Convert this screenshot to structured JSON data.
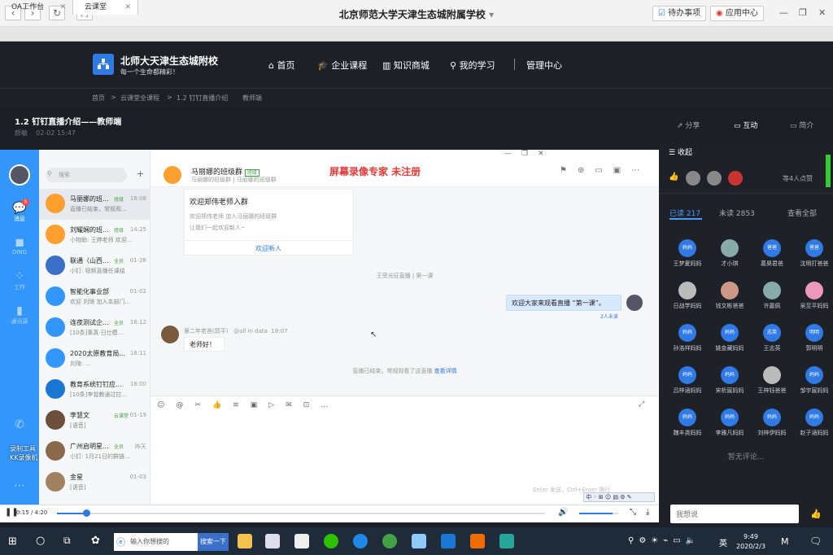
{
  "browser": {
    "title": "北京师范大学天津生态城附属学校",
    "title_caret": "▾",
    "todo_label": "待办事项",
    "apps_label": "应用中心",
    "tabs": [
      {
        "label": "OA工作台"
      },
      {
        "label": "云课堂"
      }
    ]
  },
  "site": {
    "name": "北师大天津生态城附校",
    "slogan": "每一个生命都精彩！",
    "nav": [
      {
        "label": "首页",
        "icon": "home-icon"
      },
      {
        "label": "企业课程",
        "icon": "graduation-cap-icon"
      },
      {
        "label": "知识商城",
        "icon": "books-icon"
      },
      {
        "label": "我的学习",
        "icon": "person-icon"
      },
      {
        "label": "管理中心",
        "icon": ""
      }
    ],
    "breadcrumb": [
      "首页",
      "云课堂全课程",
      "1.2 钉钉直播介绍",
      "教师端"
    ]
  },
  "video_header": {
    "title": "1.2 钉钉直播介绍——教师端",
    "author": "颜敏",
    "date": "02-02 15:47",
    "actions": [
      {
        "label": "分享"
      },
      {
        "label": "互动"
      },
      {
        "label": "简介"
      }
    ]
  },
  "dingtalk": {
    "sidebar": [
      {
        "label": "消息",
        "badge": "5"
      },
      {
        "label": "DING"
      },
      {
        "label": "工作"
      },
      {
        "label": "通讯录"
      }
    ],
    "search_placeholder": "搜索",
    "add": "+",
    "conversations": [
      {
        "name": "马丽娜的班...",
        "tag": "班级",
        "time": "18:08",
        "preview": "直播已结束，常规观..."
      },
      {
        "name": "刘耀娴的班...",
        "tag": "班级",
        "time": "14:25",
        "preview": "小物助: 王婷老师 欢迎..."
      },
      {
        "name": "联通（山西...",
        "tag": "全员",
        "time": "01-26",
        "preview": "小钉: 视频直播任课组"
      },
      {
        "name": "智能化事业部",
        "tag": "",
        "time": "01-02",
        "preview": "欢迎 刘琦 加入本部门..."
      },
      {
        "name": "连夜测试企...",
        "tag": "全员",
        "time": "18:12",
        "preview": "[10条]事真·日仕模..."
      },
      {
        "name": "2020太原教育局...",
        "tag": "",
        "time": "18:11",
        "preview": "刘琦: ..."
      },
      {
        "name": "教育系统钉钉应...",
        "tag": "",
        "time": "18:00",
        "preview": "[10条]李曾教通过拉..."
      },
      {
        "name": "李慧文",
        "tag": "云课堂",
        "time": "01-19",
        "preview": "[语音]"
      },
      {
        "name": "广州启明星...",
        "tag": "全员",
        "time": "昨天",
        "preview": "小钉: 1月21日的群链..."
      },
      {
        "name": "金星",
        "tag": "",
        "time": "01-03",
        "preview": "[语音]"
      }
    ],
    "group_title": "马丽娜的班级群",
    "group_tag": "班级",
    "group_sub": "马丽娜的班级群 | 马丽娜的班级群",
    "watermark": "屏幕录像专家  未注册",
    "welcome_title": "欢迎郑伟老师入群",
    "welcome_line1": "欢迎郑伟老师 加入马丽娜的班级群",
    "welcome_line2": "让我们一起欢迎新人~",
    "welcome_btn": "欢迎新人",
    "sys1": "王受光征直播 | 第一课",
    "my_msg": "欢迎大家来观看直播 “第一课”。",
    "my_msg_read": "2人未读",
    "other_name": "第二年老爸(郭平)",
    "other_at": "@all in data",
    "other_time": "18:07",
    "other_msg": "老师好！",
    "sys2": "直播已结束，常规观看了这直播",
    "sys2_link": "查看详情",
    "toolbar": [
      "☺",
      "@",
      "✂",
      "👍",
      "≡",
      "▣",
      "▷",
      "✉",
      "⊡",
      "…"
    ],
    "send_hint": "Enter 发送，Ctrl+Enter 换行"
  },
  "player": {
    "time": "0:15 / 4:20",
    "progress": 0.06,
    "volume": 0.85
  },
  "right_panel": {
    "collapse": "收起",
    "likes": "等4人点赞",
    "tab_read": "已读 217",
    "tab_unread": "未读 2853",
    "view_all": "查看全部",
    "viewers": [
      {
        "avatar": "妈妈",
        "name": "王梦夏妈妈"
      },
      {
        "avatar": "",
        "name": "才小琪"
      },
      {
        "avatar": "爸爸",
        "name": "葛昊君爸"
      },
      {
        "avatar": "爸爸",
        "name": "沈明打爸爸"
      },
      {
        "avatar": "",
        "name": "日战学妈妈"
      },
      {
        "avatar": "",
        "name": "钱文彬爸爸"
      },
      {
        "avatar": "",
        "name": "许嘉佩"
      },
      {
        "avatar": "",
        "name": "吴至平妈妈"
      },
      {
        "avatar": "妈妈",
        "name": "孙浩祥妈妈"
      },
      {
        "avatar": "妈妈",
        "name": "姚金藏妈妈"
      },
      {
        "avatar": "志英",
        "name": "王志英"
      },
      {
        "avatar": "明明",
        "name": "郭明明"
      },
      {
        "avatar": "妈妈",
        "name": "吕梓涵妈妈"
      },
      {
        "avatar": "妈妈",
        "name": "宋析宸妈妈"
      },
      {
        "avatar": "",
        "name": "王梓钰爸爸"
      },
      {
        "avatar": "妈妈",
        "name": "邹宇宸妈妈"
      },
      {
        "avatar": "妈妈",
        "name": "魏丰尧妈妈"
      },
      {
        "avatar": "妈妈",
        "name": "李雅凡妈妈"
      },
      {
        "avatar": "妈妈",
        "name": "刘梓伊妈妈"
      },
      {
        "avatar": "妈妈",
        "name": "赵子涵妈妈"
      }
    ],
    "no_comment": "暂无评论...",
    "comment_placeholder": "我想说"
  },
  "taskbar": {
    "search_placeholder": "输入你想搜的",
    "search_btn": "搜索一下",
    "time": "9:49",
    "date": "2020/2/3",
    "ime": "英"
  }
}
